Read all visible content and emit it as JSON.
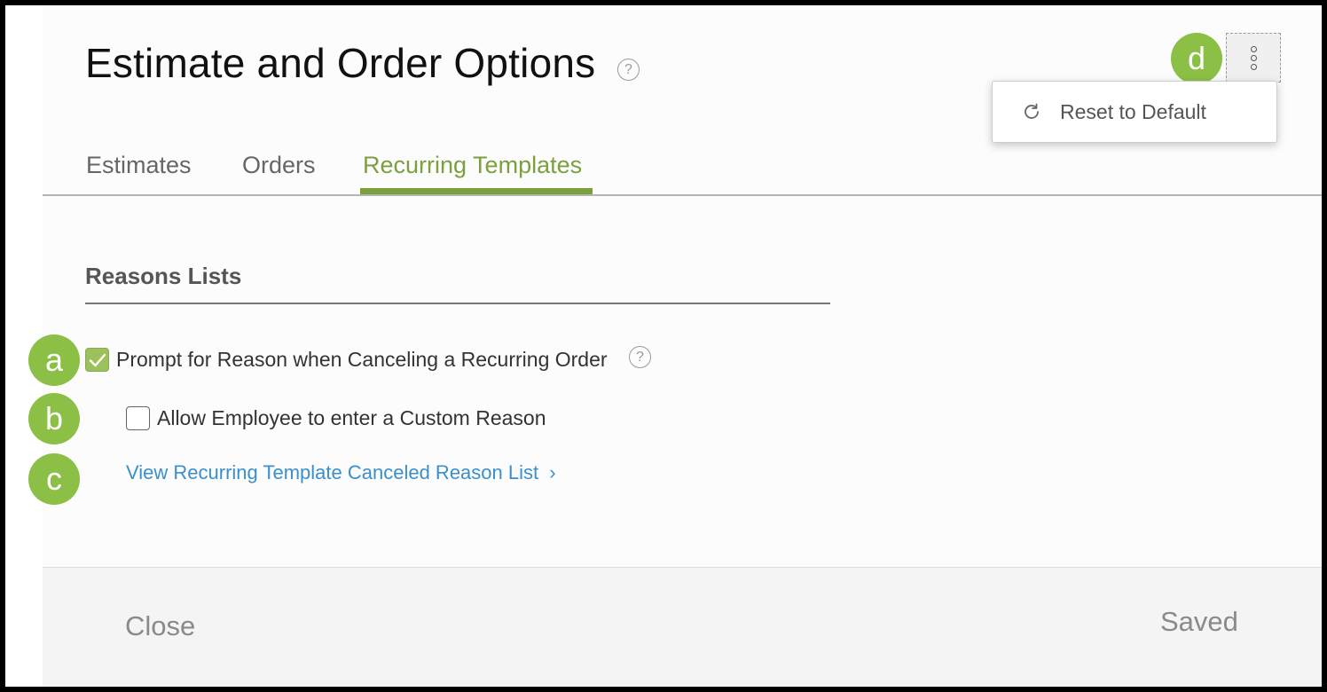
{
  "header": {
    "title": "Estimate and Order Options",
    "help_glyph": "?"
  },
  "overflow_menu": {
    "items": [
      {
        "label": "Reset to Default",
        "icon": "refresh-icon"
      }
    ]
  },
  "tabs": [
    {
      "label": "Estimates",
      "active": false
    },
    {
      "label": "Orders",
      "active": false
    },
    {
      "label": "Recurring Templates",
      "active": true
    }
  ],
  "section": {
    "title": "Reasons Lists",
    "options": [
      {
        "label": "Prompt for Reason when Canceling a Recurring Order",
        "checked": true
      },
      {
        "label": "Allow Employee to enter a Custom Reason",
        "checked": false
      }
    ],
    "link": {
      "label": "View Recurring Template Canceled Reason List",
      "chevron": "›"
    }
  },
  "footer": {
    "close_label": "Close",
    "status_label": "Saved"
  },
  "callouts": [
    "a",
    "b",
    "c",
    "d"
  ],
  "colors": {
    "accent_green": "#7ca03e",
    "callout_green": "#8bbf45",
    "link_blue": "#3b8fcc"
  }
}
